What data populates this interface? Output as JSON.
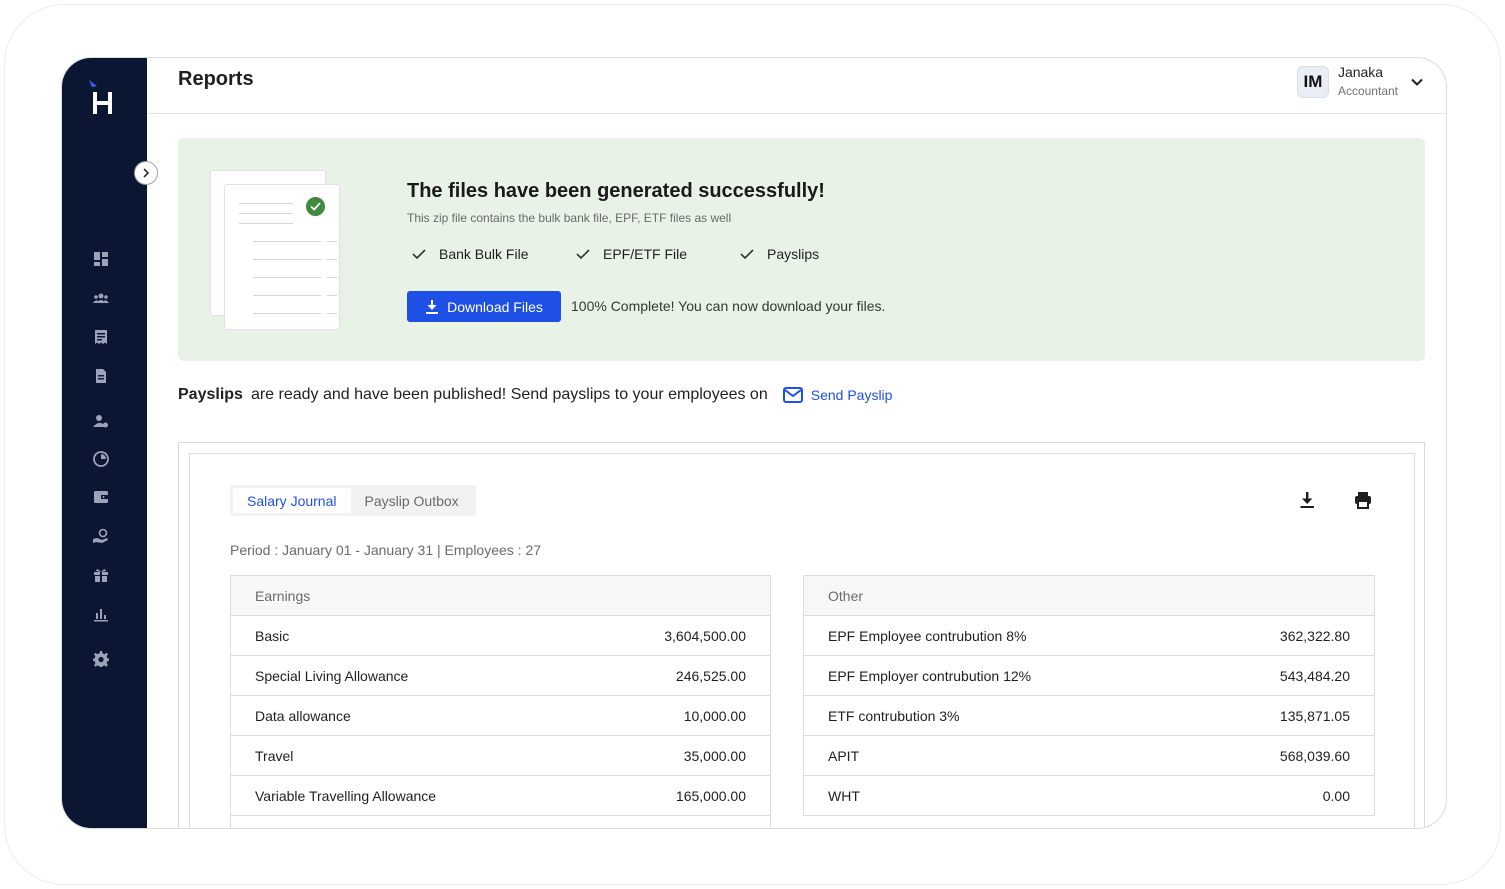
{
  "page": {
    "title": "Reports"
  },
  "user": {
    "initials": "IM",
    "name": "Janaka",
    "role": "Accountant"
  },
  "sidebar": {
    "items": [
      {
        "icon": "dashboard-icon"
      },
      {
        "icon": "people-icon"
      },
      {
        "icon": "receipt-icon"
      },
      {
        "icon": "document-icon"
      },
      {
        "icon": "user-settings-icon"
      },
      {
        "icon": "clock-icon"
      },
      {
        "icon": "wallet-icon"
      },
      {
        "icon": "hand-coin-icon"
      },
      {
        "icon": "gift-icon"
      },
      {
        "icon": "bar-chart-icon"
      },
      {
        "icon": "gear-icon"
      }
    ]
  },
  "success": {
    "title": "The files have been generated successfully!",
    "subtitle": "This zip file contains the bulk bank file, EPF, ETF files as well",
    "files": [
      "Bank Bulk File",
      "EPF/ETF File",
      "Payslips"
    ],
    "download_label": "Download Files",
    "status": "100% Complete! You can now download your files."
  },
  "payslip_notice": {
    "bold": "Payslips",
    "text": "are ready and have been published! Send payslips to your employees on",
    "link": "Send Payslip"
  },
  "journal": {
    "tabs": [
      "Salary Journal",
      "Payslip Outbox"
    ],
    "period": "Period : January 01 - January 31 | Employees : 27",
    "earnings": {
      "header": "Earnings",
      "rows": [
        {
          "label": "Basic",
          "value": "3,604,500.00"
        },
        {
          "label": "Special Living Allowance",
          "value": "246,525.00"
        },
        {
          "label": "Data allowance",
          "value": "10,000.00"
        },
        {
          "label": "Travel",
          "value": "35,000.00"
        },
        {
          "label": "Variable Travelling Allowance",
          "value": "165,000.00"
        }
      ]
    },
    "other": {
      "header": "Other",
      "rows": [
        {
          "label": "EPF Employee contrubution 8%",
          "value": "362,322.80"
        },
        {
          "label": "EPF Employer contrubution 12%",
          "value": "543,484.20"
        },
        {
          "label": "ETF contrubution 3%",
          "value": "135,871.05"
        },
        {
          "label": "APIT",
          "value": "568,039.60"
        },
        {
          "label": "WHT",
          "value": "0.00"
        }
      ]
    }
  },
  "colors": {
    "sidebar": "#0b1632",
    "accent": "#1f50e6",
    "success_bg": "#e8f2e7",
    "success_check": "#3f8a3f"
  }
}
